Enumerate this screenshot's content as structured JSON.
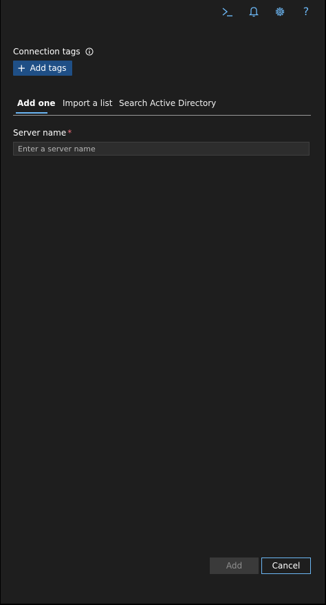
{
  "topbar": {
    "icons": [
      "cloud-shell-icon",
      "bell-icon",
      "gear-icon",
      "help-icon"
    ],
    "help_glyph": "?",
    "accent": "#6cb8f6"
  },
  "connection_tags": {
    "label": "Connection tags",
    "add_button_label": "Add tags"
  },
  "tabs": [
    {
      "label": "Add one",
      "active": true
    },
    {
      "label": "Import a list",
      "active": false
    },
    {
      "label": "Search Active Directory",
      "active": false
    }
  ],
  "server": {
    "label": "Server name",
    "required_mark": "*",
    "placeholder": "Enter a server name",
    "value": ""
  },
  "footer": {
    "add_label": "Add",
    "cancel_label": "Cancel"
  },
  "colors": {
    "background": "#1e1e1e",
    "primary_button": "#1f4f86",
    "required": "#f1707b"
  }
}
